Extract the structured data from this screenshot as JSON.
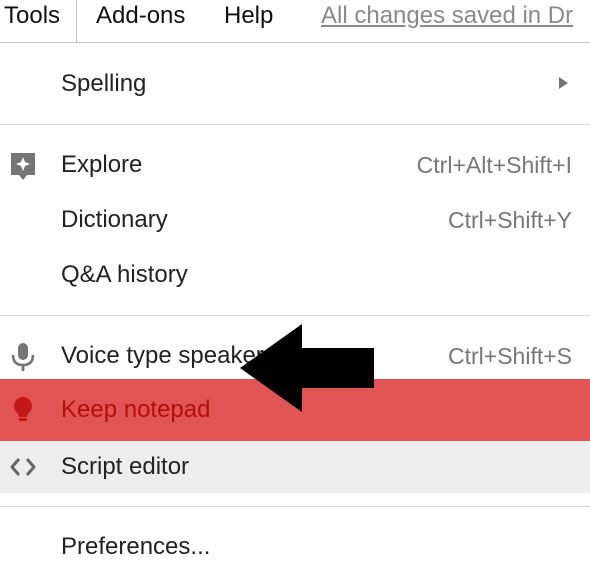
{
  "menubar": {
    "tabs": [
      {
        "label": "Tools"
      },
      {
        "label": "Add-ons"
      },
      {
        "label": "Help"
      }
    ],
    "save_status": "All changes saved in Dr"
  },
  "menu": {
    "spelling": {
      "label": "Spelling"
    },
    "explore": {
      "label": "Explore",
      "shortcut": "Ctrl+Alt+Shift+I",
      "icon": "explore-icon"
    },
    "dictionary": {
      "label": "Dictionary",
      "shortcut": "Ctrl+Shift+Y"
    },
    "qa_history": {
      "label": "Q&A history"
    },
    "voice_type": {
      "label": "Voice type speaker notes...",
      "shortcut": "Ctrl+Shift+S",
      "icon": "microphone-icon"
    },
    "keep_notepad": {
      "label": "Keep notepad",
      "icon": "lightbulb-icon"
    },
    "script_editor": {
      "label": "Script editor",
      "icon": "code-brackets-icon"
    },
    "preferences": {
      "label": "Preferences..."
    }
  },
  "colors": {
    "highlight": "#e25454",
    "highlight_text": "#b10f0f",
    "hover": "#ededed",
    "icon_gray": "#757575",
    "arrow": "#000000"
  }
}
